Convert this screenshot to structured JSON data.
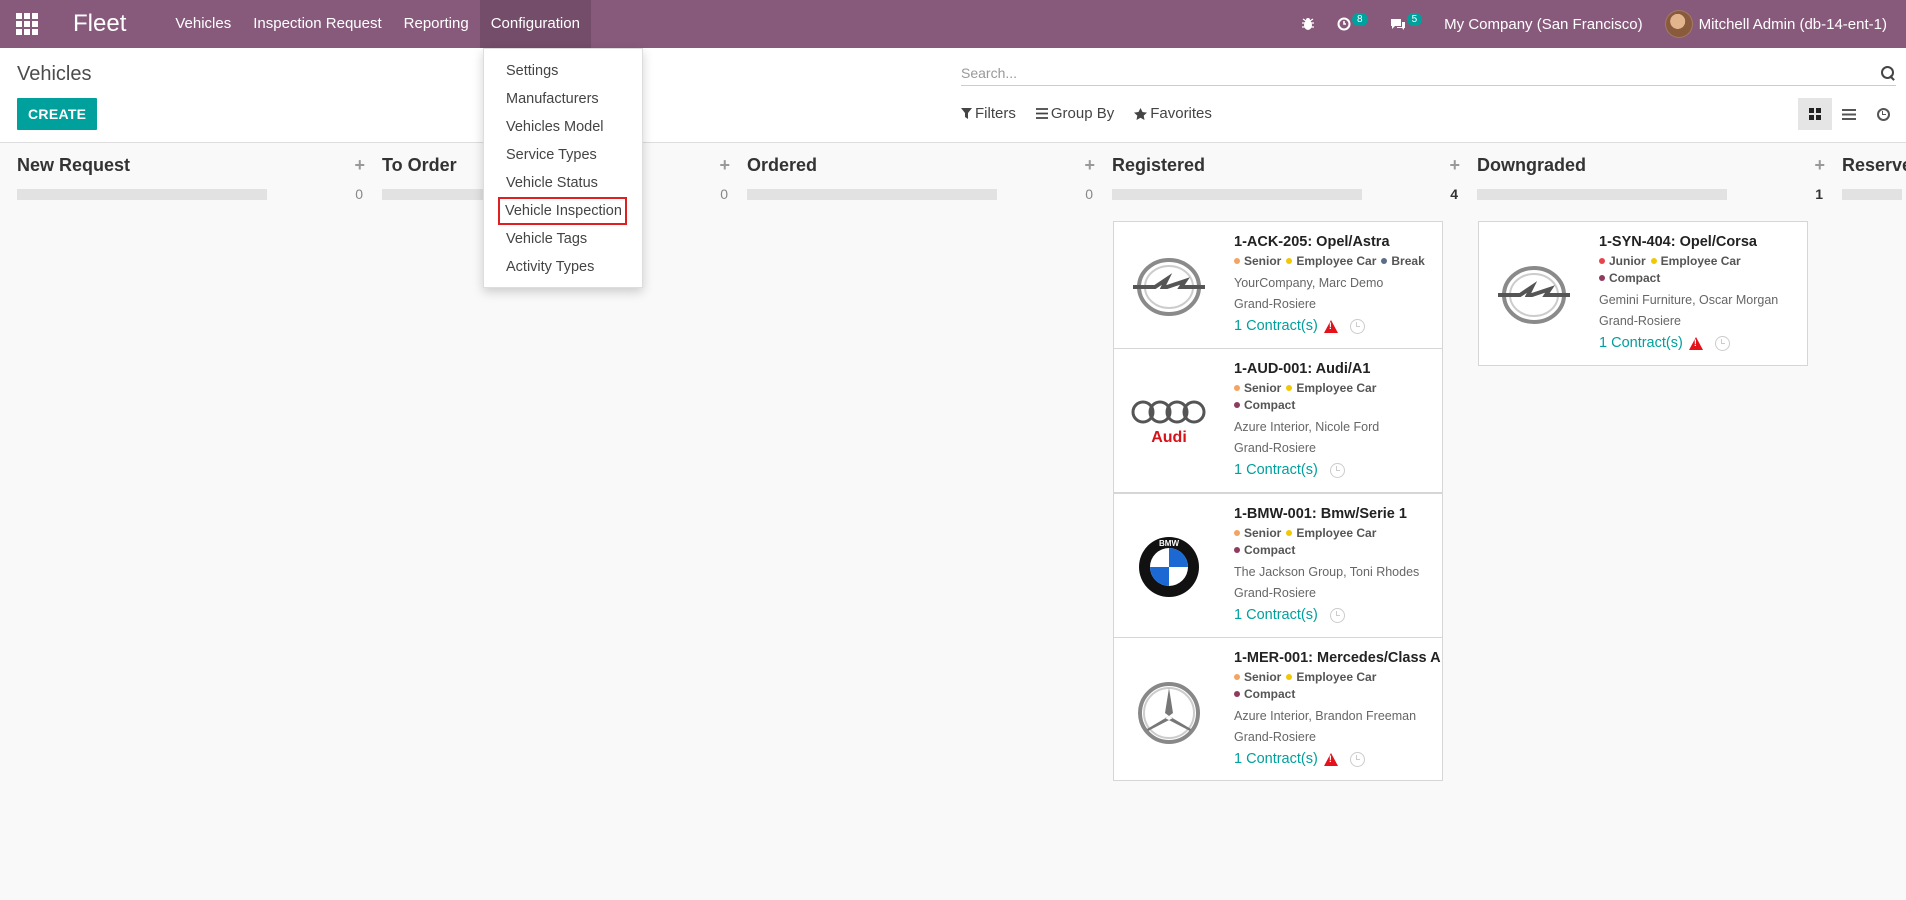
{
  "navbar": {
    "brand": "Fleet",
    "menu": [
      "Vehicles",
      "Inspection Request",
      "Reporting",
      "Configuration"
    ],
    "activity_count": "8",
    "messages_count": "5",
    "company": "My Company (San Francisco)",
    "user": "Mitchell Admin (db-14-ent-1)",
    "accent_color": "#875a7b"
  },
  "config_menu": [
    "Settings",
    "Manufacturers",
    "Vehicles Model",
    "Service Types",
    "Vehicle Status",
    "Vehicle Inspection",
    "Vehicle Tags",
    "Activity Types"
  ],
  "control_panel": {
    "breadcrumb": "Vehicles",
    "create_label": "CREATE",
    "search_placeholder": "Search...",
    "filters_label": "Filters",
    "group_by_label": "Group By",
    "favorites_label": "Favorites"
  },
  "columns": [
    {
      "title": "New Request",
      "count": "0"
    },
    {
      "title": "To Order",
      "count": "0"
    },
    {
      "title": "Ordered",
      "count": "0"
    },
    {
      "title": "Registered",
      "count": "4"
    },
    {
      "title": "Downgraded",
      "count": "1"
    },
    {
      "title": "Reserve"
    }
  ],
  "cards": {
    "registered": [
      {
        "title": "1-ACK-205: Opel/Astra",
        "tags": [
          "Senior",
          "Employee Car",
          "Break"
        ],
        "tag_colors": [
          "#f4a460",
          "#f0c808",
          "#5a6e87"
        ],
        "company": "YourCompany, Marc Demo",
        "location": "Grand-Rosiere",
        "contracts": "1 Contract(s)",
        "logo": "opel-logo",
        "warning": true
      },
      {
        "title": "1-AUD-001: Audi/A1",
        "tags": [
          "Senior",
          "Employee Car",
          "Compact"
        ],
        "tag_colors": [
          "#f4a460",
          "#f0c808",
          "#8e3b5f"
        ],
        "company": "Azure Interior, Nicole Ford",
        "location": "Grand-Rosiere",
        "contracts": "1 Contract(s)",
        "logo": "audi-logo",
        "logo_text": "Audi",
        "warning": false
      },
      {
        "title": "1-BMW-001: Bmw/Serie 1",
        "tags": [
          "Senior",
          "Employee Car",
          "Compact"
        ],
        "tag_colors": [
          "#f4a460",
          "#f0c808",
          "#8e3b5f"
        ],
        "company": "The Jackson Group, Toni Rhodes",
        "location": "Grand-Rosiere",
        "contracts": "1 Contract(s)",
        "logo": "bmw-logo",
        "logo_text": "BMW",
        "warning": false
      },
      {
        "title": "1-MER-001: Mercedes/Class A",
        "tags": [
          "Senior",
          "Employee Car",
          "Compact"
        ],
        "tag_colors": [
          "#f4a460",
          "#f0c808",
          "#8e3b5f"
        ],
        "company": "Azure Interior, Brandon Freeman",
        "location": "Grand-Rosiere",
        "contracts": "1 Contract(s)",
        "logo": "mercedes-logo",
        "warning": true
      }
    ],
    "downgraded": [
      {
        "title": "1-SYN-404: Opel/Corsa",
        "tags": [
          "Junior",
          "Employee Car",
          "Compact"
        ],
        "tag_colors": [
          "#e8434a",
          "#f0c808",
          "#8e3b5f"
        ],
        "company": "Gemini Furniture, Oscar Morgan",
        "location": "Grand-Rosiere",
        "contracts": "1 Contract(s)",
        "logo": "opel-logo",
        "warning": true
      }
    ]
  }
}
